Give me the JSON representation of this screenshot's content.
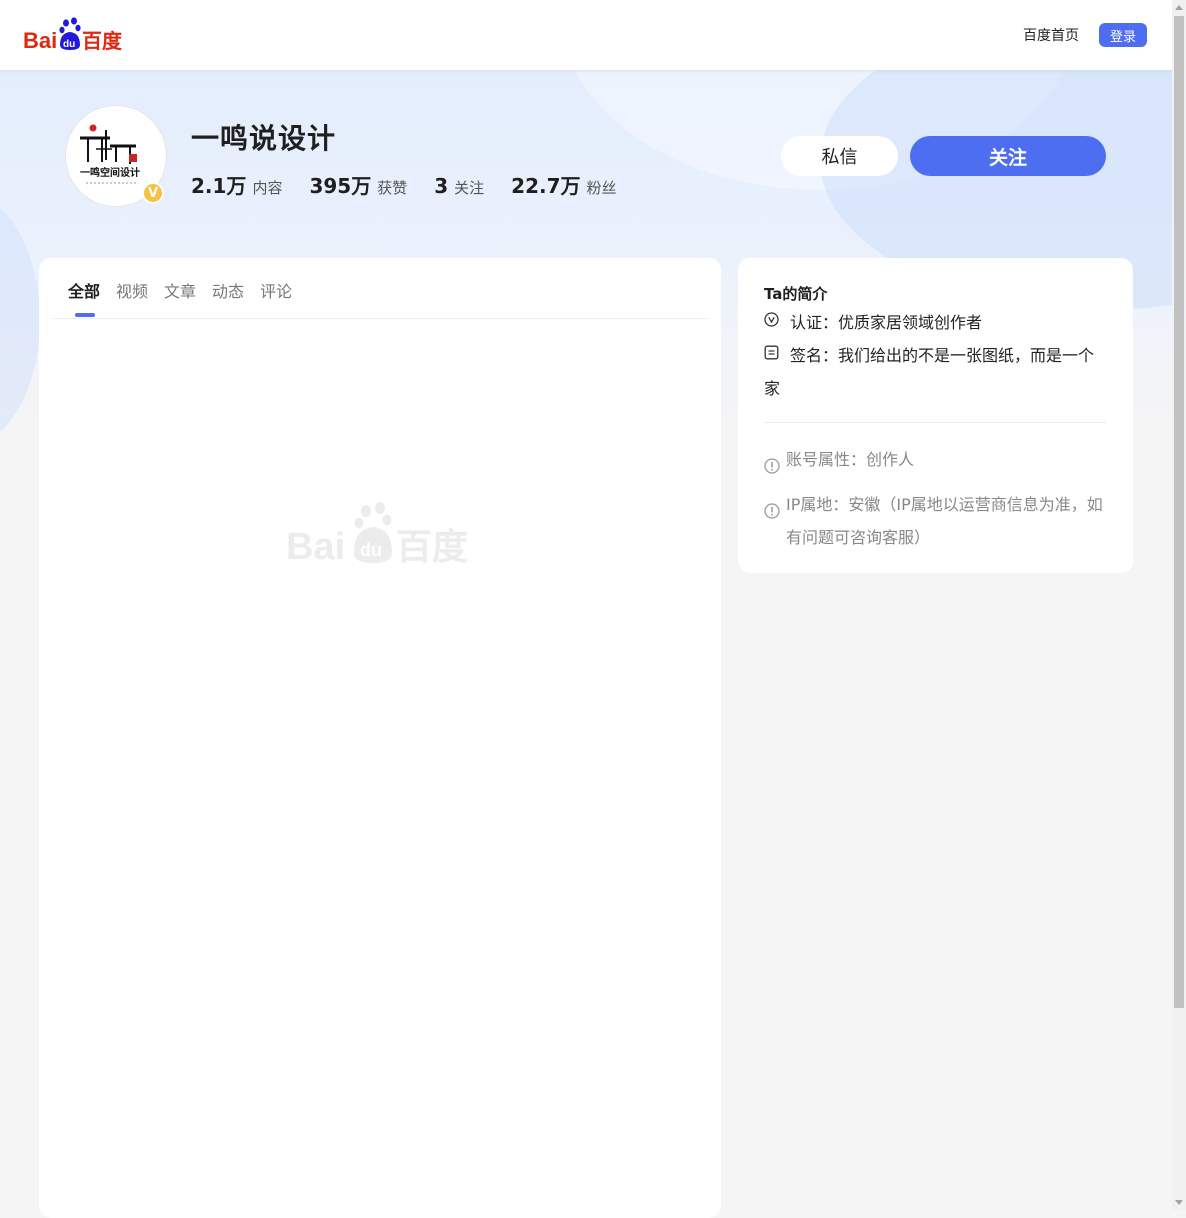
{
  "header": {
    "logo_text": "Bai du 百度",
    "home_link": "百度首页",
    "login_label": "登录"
  },
  "profile": {
    "name": "一鸣说设计",
    "avatar_art_text": "一鸣空间设计",
    "verified_badge": "V",
    "stats": [
      {
        "num": "2.1万",
        "label": "内容"
      },
      {
        "num": "395万",
        "label": "获赞"
      },
      {
        "num": "3",
        "label": "关注"
      },
      {
        "num": "22.7万",
        "label": "粉丝"
      }
    ],
    "message_label": "私信",
    "follow_label": "关注"
  },
  "tabs": [
    {
      "label": "全部",
      "active": true
    },
    {
      "label": "视频",
      "active": false
    },
    {
      "label": "文章",
      "active": false
    },
    {
      "label": "动态",
      "active": false
    },
    {
      "label": "评论",
      "active": false
    }
  ],
  "intro": {
    "title": "Ta的简介",
    "certification": "认证：优质家居领域创作者",
    "signature": "签名：我们给出的不是一张图纸，而是一个家",
    "account_type": "账号属性：创作人",
    "ip_location": "IP属地：安徽（IP属地以运营商信息为准，如有问题可咨询客服）"
  },
  "colors": {
    "accent": "#4e6ef2",
    "logo_red": "#de2910",
    "logo_blue": "#2319dc",
    "badge_gold": "#f6c244"
  }
}
